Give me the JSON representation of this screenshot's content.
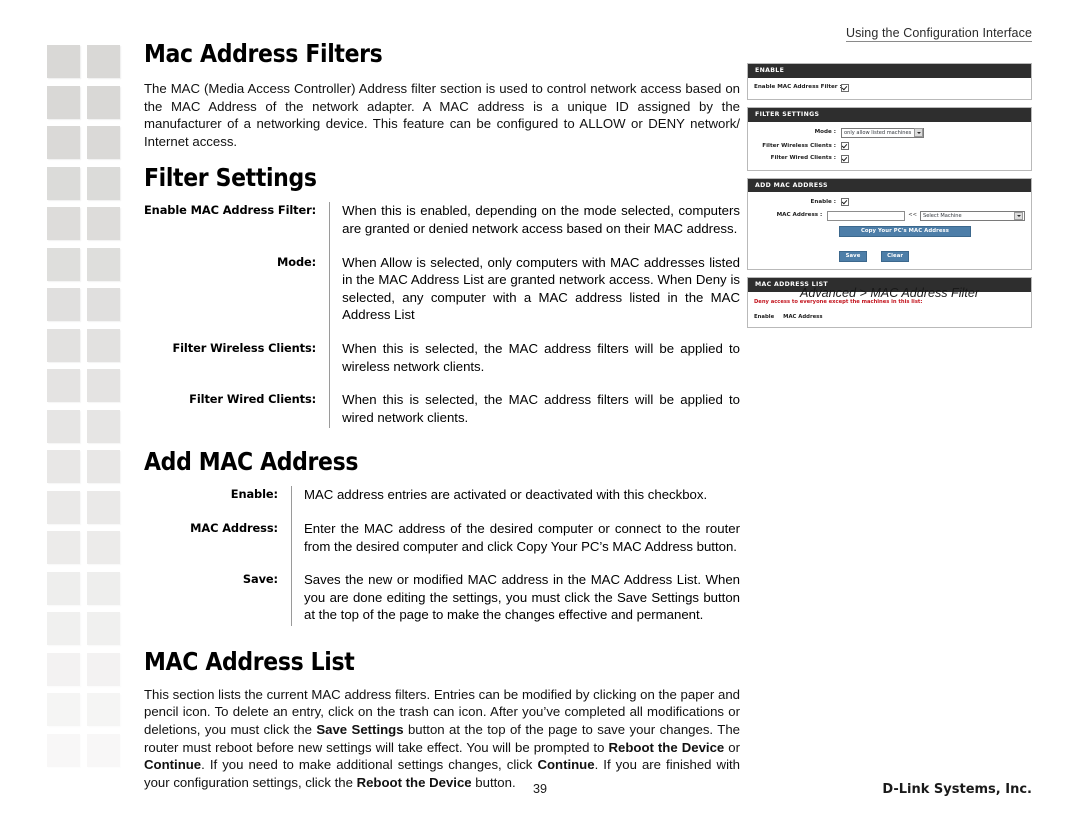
{
  "header": {
    "running_head": "Using the Configuration Interface"
  },
  "footer": {
    "page_number": "39",
    "brand": "D-Link Systems, Inc."
  },
  "sections": {
    "mac_address_filters": {
      "title": "Mac Address Filters",
      "intro": "The MAC (Media Access Controller) Address filter section is used to control network access based on the MAC Address of the network adapter. A MAC address is a unique ID assigned by the manufacturer of a networking device. This feature can be configured to ALLOW or DENY network/ Internet access."
    },
    "filter_settings": {
      "title": "Filter Settings",
      "items": [
        {
          "label": "Enable MAC Address Filter:",
          "desc": "When this is enabled, depending on the mode selected, computers are granted or denied network access based on their MAC address."
        },
        {
          "label": "Mode:",
          "desc": "When Allow is selected, only computers with MAC addresses listed in the MAC Address List are granted network access. When Deny is selected, any computer with a MAC address listed in the MAC Address List"
        },
        {
          "label": "Filter Wireless Clients:",
          "desc": "When this is selected, the MAC address filters will be applied to wireless network clients."
        },
        {
          "label": "Filter Wired Clients:",
          "desc": "When this is selected, the MAC address filters will be applied to wired network clients."
        }
      ]
    },
    "add_mac_address": {
      "title": "Add MAC Address",
      "items": [
        {
          "label": "Enable:",
          "desc": "MAC address entries are activated or deactivated with this checkbox."
        },
        {
          "label": "MAC Address:",
          "desc": "Enter the MAC address of the desired computer or connect to the router from the desired computer and click Copy Your PC’s MAC Address button."
        },
        {
          "label": "Save:",
          "desc": "Saves the new or modified MAC address in the MAC Address List. When you are done editing the settings, you must click the Save Settings button at the top of the page to make the changes effective and permanent."
        }
      ]
    },
    "mac_address_list": {
      "title": "MAC Address List",
      "paragraph_parts": [
        {
          "text": "This section lists the current MAC address filters. Entries can be modified by clicking on the paper and pencil icon. To delete an entry, click on the trash can icon. After you’ve completed all modifications or deletions, you must click the ",
          "bold": false
        },
        {
          "text": "Save Settings",
          "bold": true
        },
        {
          "text": " button at the top of the page to save your changes. The router must reboot before new settings will take effect. You will be prompted to ",
          "bold": false
        },
        {
          "text": "Reboot the Device",
          "bold": true
        },
        {
          "text": " or ",
          "bold": false
        },
        {
          "text": "Continue",
          "bold": true
        },
        {
          "text": ". If you need to make additional settings changes, click ",
          "bold": false
        },
        {
          "text": "Continue",
          "bold": true
        },
        {
          "text": ". If you are finished with your configuration settings, click the ",
          "bold": false
        },
        {
          "text": "Reboot the Device",
          "bold": true
        },
        {
          "text": " button.",
          "bold": false
        }
      ]
    }
  },
  "ui_capture": {
    "caption": "Advanced > MAC Address Filter",
    "accent_button_color": "#4d7ea8",
    "panel_header_color": "#2e2e2e",
    "warning_text_color": "#c3141e",
    "panels": {
      "enable": {
        "title": "ENABLE",
        "rows": [
          {
            "label": "Enable MAC Address Filter :",
            "control": "checkbox",
            "checked": true
          }
        ]
      },
      "filter_settings": {
        "title": "FILTER SETTINGS",
        "mode_label": "Mode :",
        "mode_value": "only allow listed machines",
        "rows": [
          {
            "label": "Filter Wireless Clients :",
            "control": "checkbox",
            "checked": true
          },
          {
            "label": "Filter Wired Clients :",
            "control": "checkbox",
            "checked": true
          }
        ]
      },
      "add_mac_address": {
        "title": "ADD MAC ADDRESS",
        "enable_label": "Enable :",
        "mac_label": "MAC Address :",
        "mac_value": "",
        "arrows": "<<",
        "select_machine_value": "Select Machine",
        "copy_button": "Copy Your PC's MAC Address",
        "save_button": "Save",
        "clear_button": "Clear"
      },
      "mac_address_list": {
        "title": "MAC ADDRESS LIST",
        "warning": "Deny access to everyone except the machines in this list:",
        "col_enable": "Enable",
        "col_mac": "MAC Address"
      }
    }
  },
  "decor": {
    "square_color": "#d9d8d6",
    "rows": 18,
    "cols": 2
  }
}
